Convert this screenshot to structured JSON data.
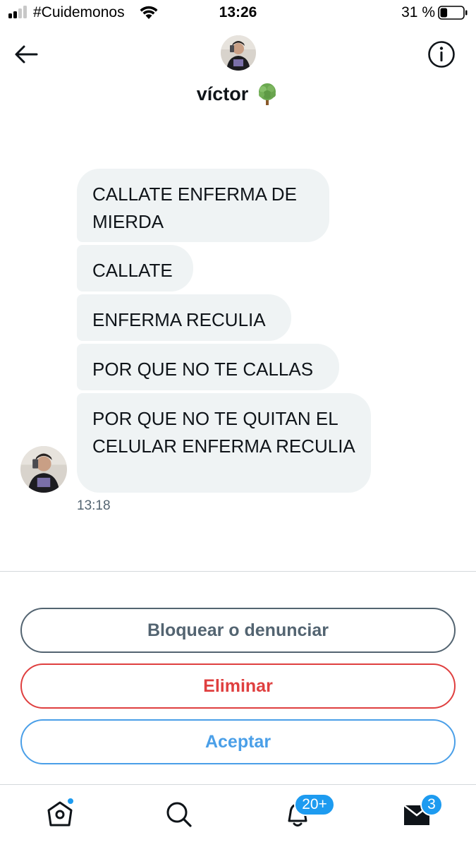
{
  "status_bar": {
    "carrier": "#Cuidemonos",
    "time": "13:26",
    "battery_percent": "31 %",
    "signal_bars_active": 2,
    "signal_bars_total": 4,
    "battery_level": 0.31
  },
  "header": {
    "name": "víctor",
    "name_emoji_icon": "tree-emoji-icon",
    "back_icon": "arrow-left-icon",
    "info_icon": "info-icon"
  },
  "messages": [
    {
      "text": "CALLATE ENFERMA DE MIERDA"
    },
    {
      "text": "CALLATE"
    },
    {
      "text": "ENFERMA RECULIA"
    },
    {
      "text": "POR QUE NO TE CALLAS"
    },
    {
      "text": "POR QUE NO TE QUITAN EL CELULAR ENFERMA RECULIA"
    }
  ],
  "message_time": "13:18",
  "actions": {
    "block_label": "Bloquear o denunciar",
    "delete_label": "Eliminar",
    "accept_label": "Aceptar"
  },
  "tab_bar": {
    "items": [
      {
        "icon": "home-icon",
        "has_dot": true
      },
      {
        "icon": "search-icon"
      },
      {
        "icon": "bell-icon",
        "badge": "20+"
      },
      {
        "icon": "mail-icon",
        "badge": "3"
      }
    ]
  },
  "colors": {
    "bubble_bg": "#eff3f4",
    "accent_blue": "#1d9bf0",
    "button_blue": "#4a9fe8",
    "delete_red": "#df3f3f",
    "muted_gray": "#536471"
  }
}
